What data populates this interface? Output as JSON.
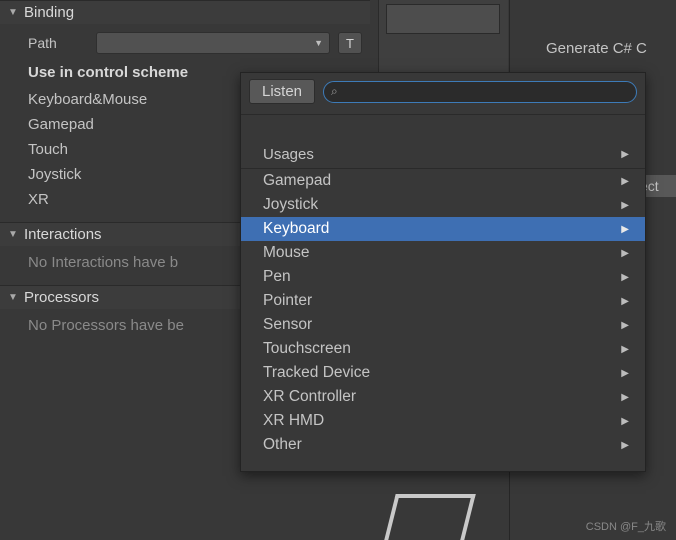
{
  "inspector": {
    "binding_header": "Binding",
    "path_label": "Path",
    "t_button": "T",
    "use_scheme_header": "Use in control scheme",
    "schemes": [
      "Keyboard&Mouse",
      "Gamepad",
      "Touch",
      "Joystick",
      "XR"
    ],
    "interactions_header": "Interactions",
    "interactions_empty": "No Interactions have b",
    "processors_header": "Processors",
    "processors_empty": "No Processors have be"
  },
  "right": {
    "generate": "Generate C# C",
    "partial": "ect"
  },
  "popup": {
    "listen": "Listen",
    "search_placeholder": "",
    "usages": "Usages",
    "items": [
      {
        "label": "Gamepad",
        "selected": false
      },
      {
        "label": "Joystick",
        "selected": false
      },
      {
        "label": "Keyboard",
        "selected": true
      },
      {
        "label": "Mouse",
        "selected": false
      },
      {
        "label": "Pen",
        "selected": false
      },
      {
        "label": "Pointer",
        "selected": false
      },
      {
        "label": "Sensor",
        "selected": false
      },
      {
        "label": "Touchscreen",
        "selected": false
      },
      {
        "label": "Tracked Device",
        "selected": false
      },
      {
        "label": "XR Controller",
        "selected": false
      },
      {
        "label": "XR HMD",
        "selected": false
      },
      {
        "label": "Other",
        "selected": false
      }
    ]
  },
  "watermark": "CSDN @F_九歌"
}
